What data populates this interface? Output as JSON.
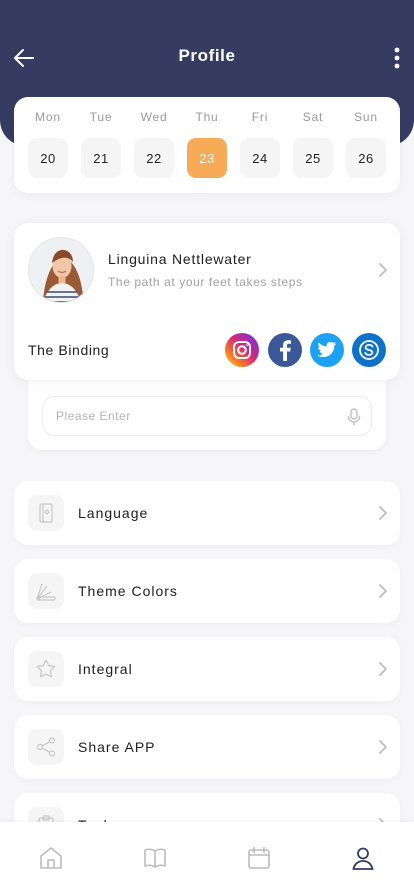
{
  "header": {
    "title": "Profile",
    "background_color": "#363c61",
    "back_icon": "arrow-left-icon",
    "more_icon": "more-vertical-icon"
  },
  "week": {
    "days": [
      {
        "name": "Mon",
        "date": "20"
      },
      {
        "name": "Tue",
        "date": "21"
      },
      {
        "name": "Wed",
        "date": "22"
      },
      {
        "name": "Thu",
        "date": "23"
      },
      {
        "name": "Fri",
        "date": "24"
      },
      {
        "name": "Sat",
        "date": "25"
      },
      {
        "name": "Sun",
        "date": "26"
      }
    ],
    "selected_date": "23",
    "accent_color": "#f7ab56"
  },
  "profile": {
    "name": "Linguina Nettlewater",
    "motto": "The path at your feet takes steps",
    "binding_label": "The Binding",
    "socials": [
      {
        "name": "Instagram",
        "icon": "instagram-icon",
        "color": "#dd2a7b"
      },
      {
        "name": "Facebook",
        "icon": "facebook-icon",
        "color": "#3b5998"
      },
      {
        "name": "Twitter",
        "icon": "twitter-icon",
        "color": "#1da1f2"
      },
      {
        "name": "Skype",
        "icon": "skype-icon",
        "color": "#0e72c6"
      }
    ]
  },
  "binding_input": {
    "value": "",
    "placeholder": "Please Enter",
    "icon": "microphone-icon"
  },
  "menu": {
    "items": [
      {
        "label": "Language",
        "icon": "language-icon"
      },
      {
        "label": "Theme Colors",
        "icon": "palette-icon"
      },
      {
        "label": "Integral",
        "icon": "star-icon"
      },
      {
        "label": "Share APP",
        "icon": "share-icon"
      },
      {
        "label": "Tool",
        "icon": "clipboard-icon"
      }
    ]
  },
  "tabbar": {
    "items": [
      {
        "name": "Home",
        "icon": "home-icon"
      },
      {
        "name": "Book",
        "icon": "book-icon"
      },
      {
        "name": "Calendar",
        "icon": "calendar-icon"
      },
      {
        "name": "Profile",
        "icon": "user-icon"
      }
    ],
    "active": "Profile"
  }
}
